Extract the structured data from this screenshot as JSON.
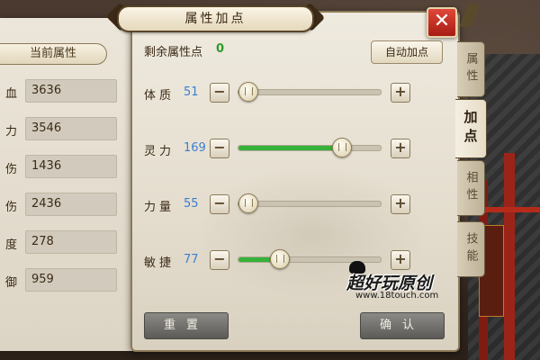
{
  "left_panel": {
    "header": "当前属性",
    "stats": [
      {
        "label": "血",
        "value": "3636"
      },
      {
        "label": "力",
        "value": "3546"
      },
      {
        "label": "伤",
        "value": "1436"
      },
      {
        "label": "伤",
        "value": "2436"
      },
      {
        "label": "度",
        "value": "278"
      },
      {
        "label": "御",
        "value": "959"
      }
    ]
  },
  "dialog": {
    "title": "属性加点",
    "remaining_label": "剩余属性点",
    "remaining_value": "0",
    "auto_button": "自动加点",
    "close_label": "✕",
    "attributes": [
      {
        "label": "体质",
        "value": "51",
        "fill": 0.0
      },
      {
        "label": "灵力",
        "value": "169",
        "fill": 0.75
      },
      {
        "label": "力量",
        "value": "55",
        "fill": 0.0
      },
      {
        "label": "敏捷",
        "value": "77",
        "fill": 0.25
      }
    ],
    "minus_label": "−",
    "plus_label": "+",
    "reset_button": "重置",
    "confirm_button": "确认"
  },
  "tabs": [
    {
      "label": "属性",
      "active": false
    },
    {
      "label": "加点",
      "active": true
    },
    {
      "label": "相性",
      "active": false
    },
    {
      "label": "技能",
      "active": false
    }
  ],
  "watermark": {
    "logo": "超好玩原创",
    "url": "www.18touch.com"
  },
  "colors": {
    "slider_fill": "#35b23a",
    "attribute_value": "#3a7fcf",
    "remaining_value": "#2e9b2e",
    "close_button": "#c8281e"
  }
}
